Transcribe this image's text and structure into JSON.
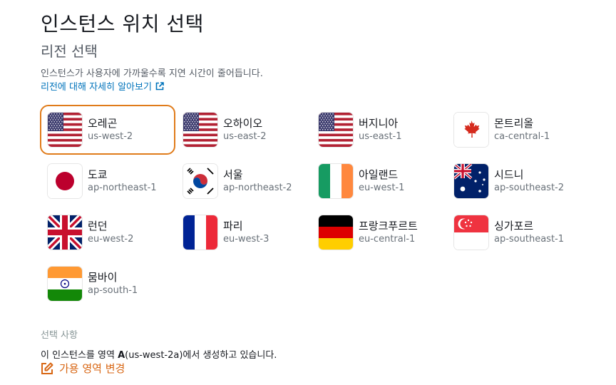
{
  "header": {
    "title": "인스턴스 위치 선택",
    "subtitle": "리전 선택",
    "description": "인스턴스가 사용자에 가까울수록 지연 시간이 줄어듭니다.",
    "learn_more": "리전에 대해 자세히 알아보기"
  },
  "regions": [
    {
      "name": "오레곤",
      "code": "us-west-2",
      "flag": "us-flag",
      "selected": true
    },
    {
      "name": "오하이오",
      "code": "us-east-2",
      "flag": "us-flag"
    },
    {
      "name": "버지니아",
      "code": "us-east-1",
      "flag": "us-flag"
    },
    {
      "name": "몬트리올",
      "code": "ca-central-1",
      "flag": "canada-flag"
    },
    {
      "name": "도쿄",
      "code": "ap-northeast-1",
      "flag": "japan-flag"
    },
    {
      "name": "서울",
      "code": "ap-northeast-2",
      "flag": "korea-flag"
    },
    {
      "name": "아일랜드",
      "code": "eu-west-1",
      "flag": "ireland-flag"
    },
    {
      "name": "시드니",
      "code": "ap-southeast-2",
      "flag": "australia-flag"
    },
    {
      "name": "런던",
      "code": "eu-west-2",
      "flag": "uk-flag"
    },
    {
      "name": "파리",
      "code": "eu-west-3",
      "flag": "france-flag"
    },
    {
      "name": "프랑크푸르트",
      "code": "eu-central-1",
      "flag": "germany-flag"
    },
    {
      "name": "싱가포르",
      "code": "ap-southeast-1",
      "flag": "singapore-flag"
    },
    {
      "name": "뭄바이",
      "code": "ap-south-1",
      "flag": "india-flag"
    }
  ],
  "optional": {
    "label": "선택 사항",
    "zone_prefix": "이 인스턴스를 영역 ",
    "zone_bold": "A",
    "zone_suffix": "(us-west-2a)에서 생성하고 있습니다.",
    "change_label": "가용 영역 변경"
  },
  "colors": {
    "accent": "#e07b1a",
    "link": "#0073bb"
  }
}
